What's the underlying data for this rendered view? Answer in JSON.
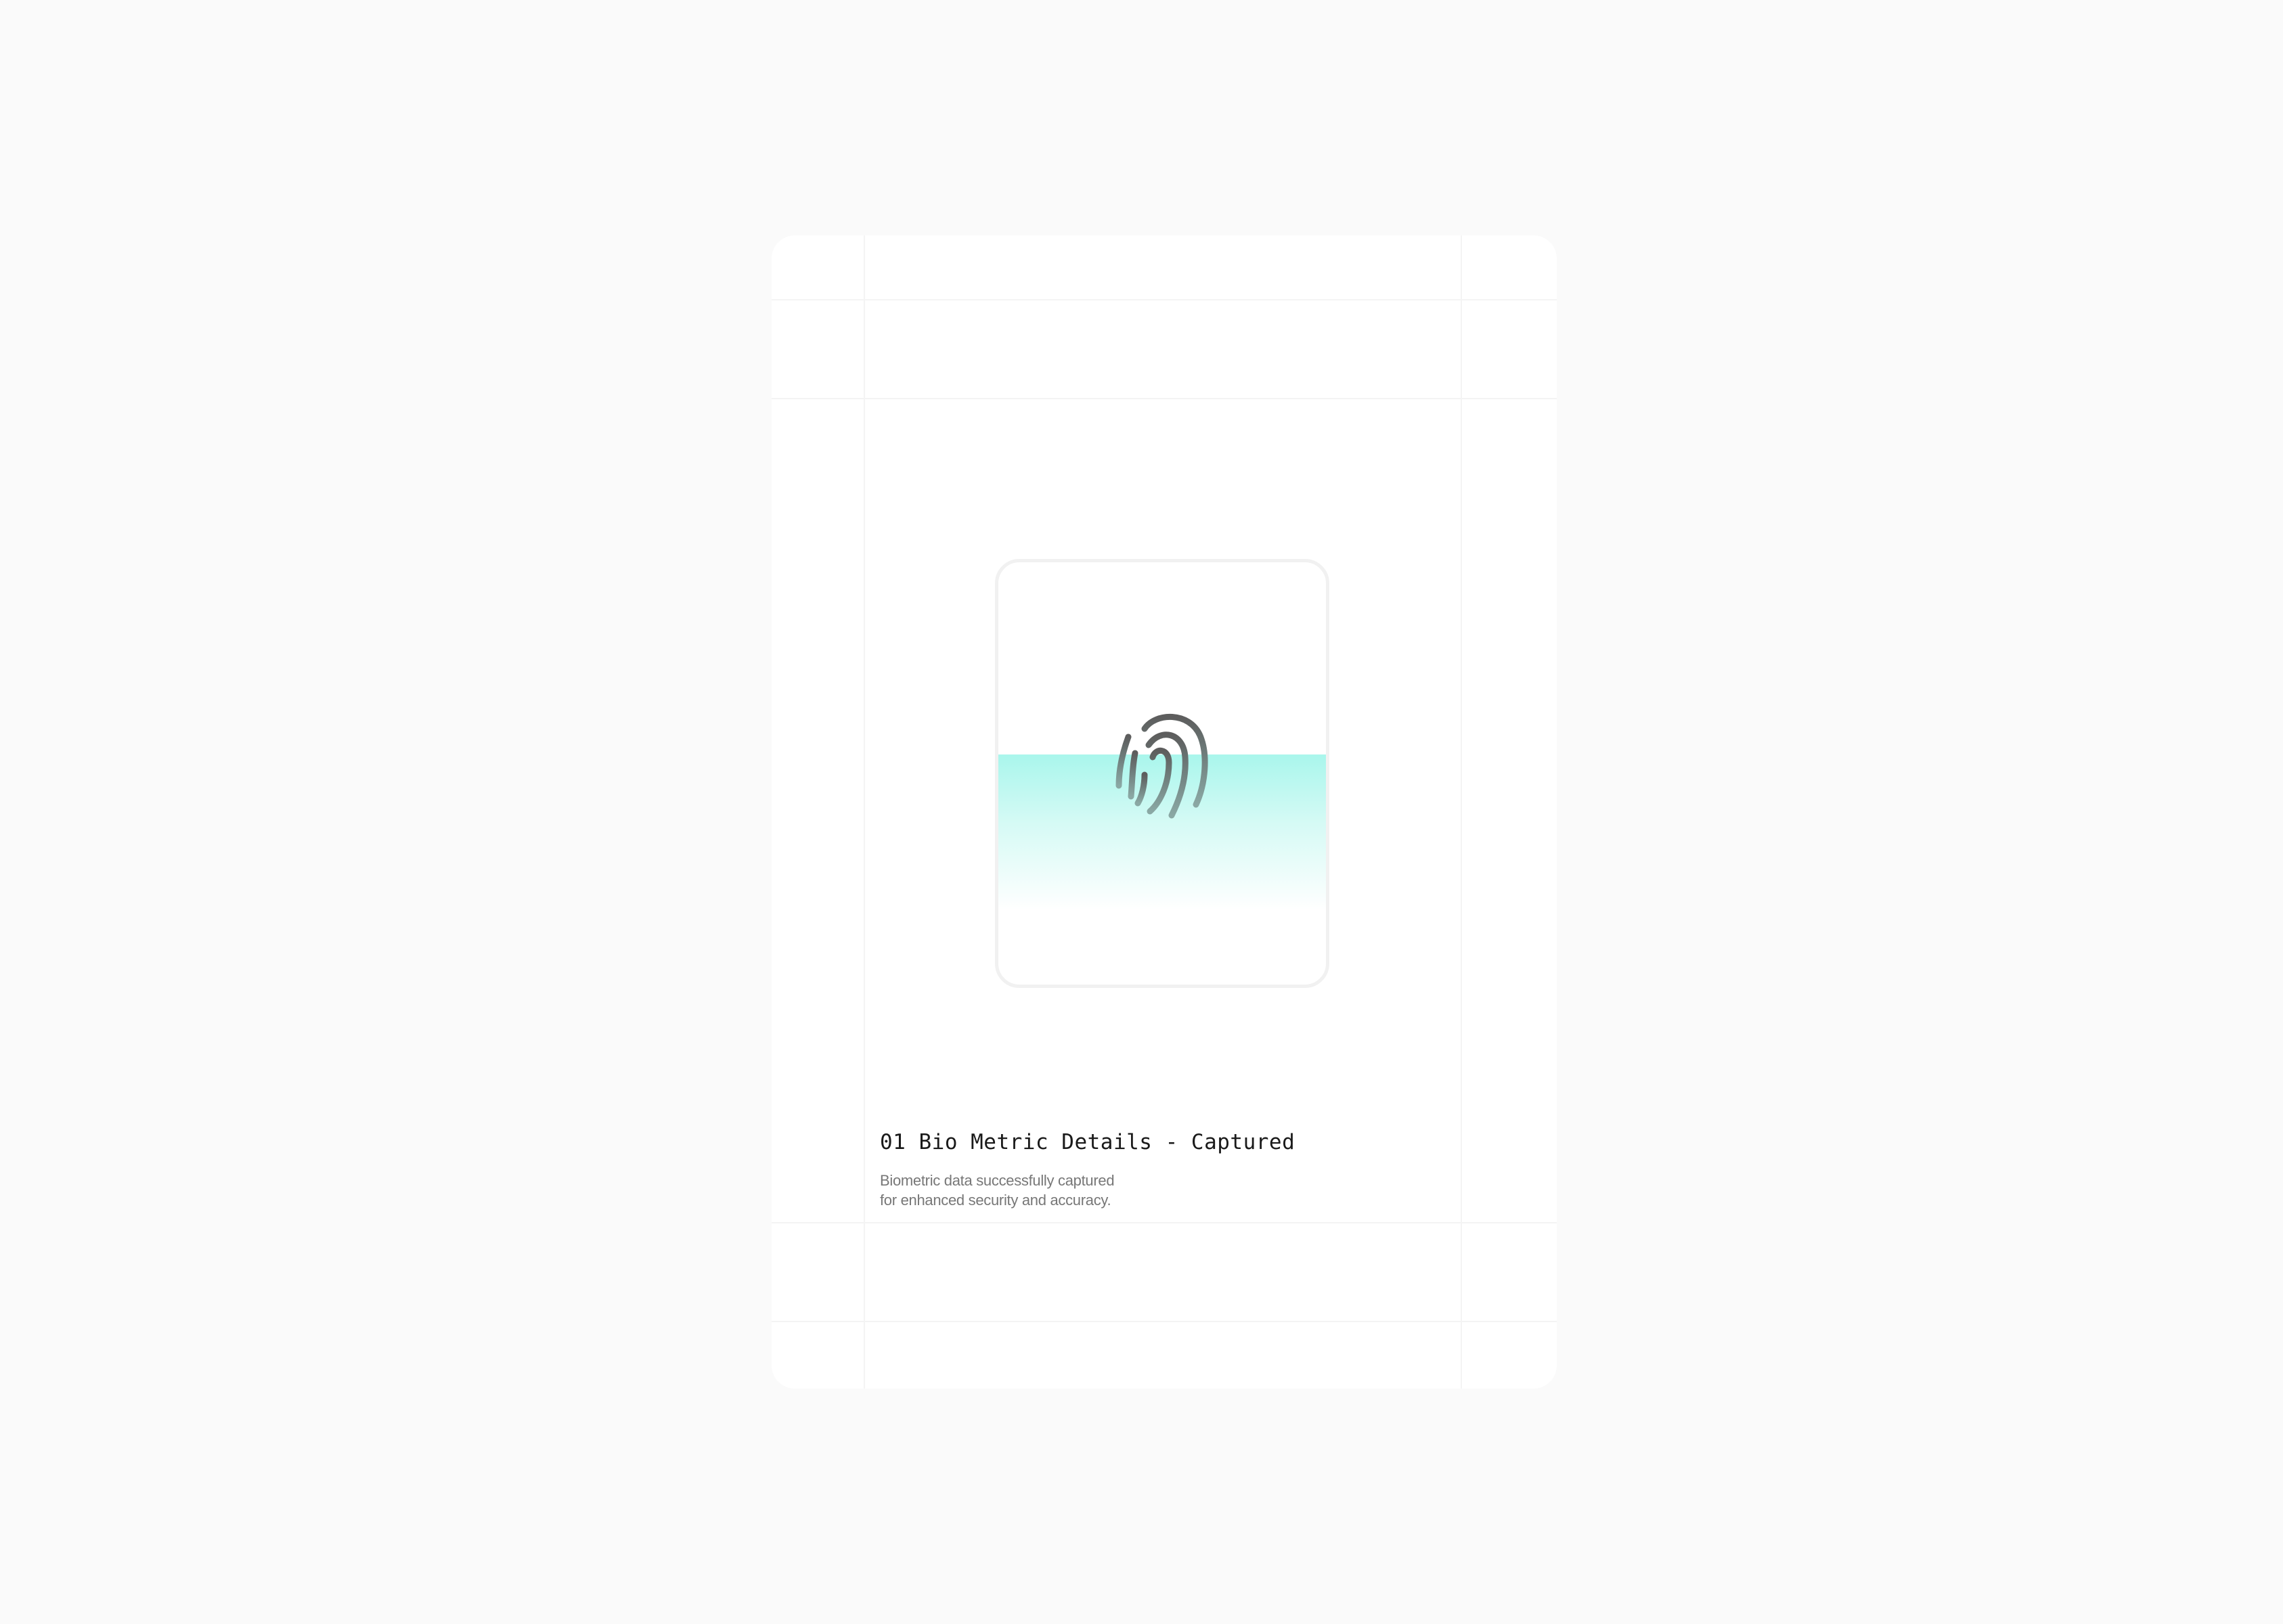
{
  "card": {
    "title": "01 Bio Metric Details - Captured",
    "description_line1": "Biometric data successfully captured",
    "description_line2": "for enhanced security and accuracy."
  },
  "scanner": {
    "icon": "fingerprint-icon",
    "scan_color": "#a9f6ec",
    "icon_stroke_color": "#7a8a88"
  }
}
